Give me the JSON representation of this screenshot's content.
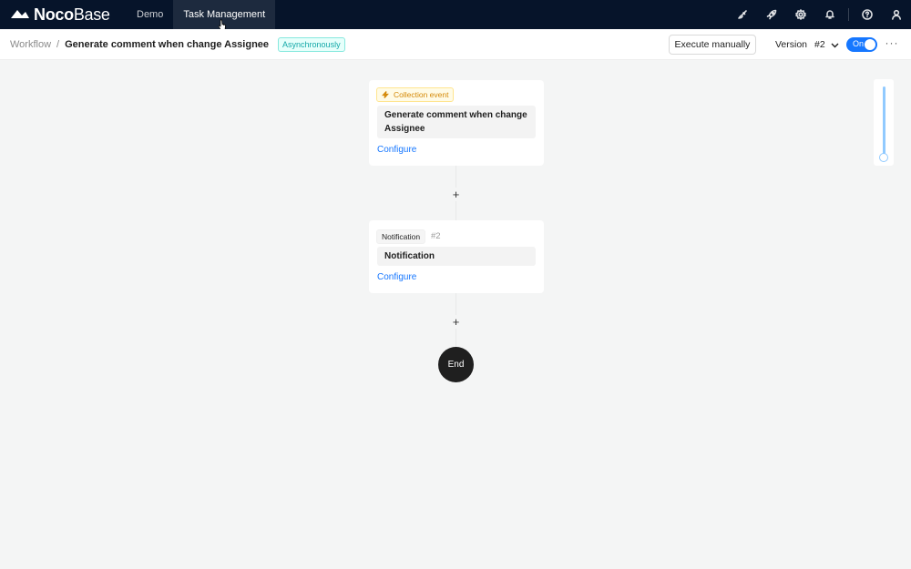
{
  "brand": {
    "name_bold": "Noco",
    "name_light": "Base"
  },
  "nav": {
    "items": [
      {
        "label": "Demo"
      },
      {
        "label": "Task Management"
      }
    ]
  },
  "top_icons": [
    "brush-icon",
    "rocket-icon",
    "gear-icon",
    "bell-icon",
    "help-icon",
    "user-icon"
  ],
  "breadcrumb": {
    "root": "Workflow",
    "separator": "/",
    "current": "Generate comment when change Assignee"
  },
  "workflow": {
    "mode_tag": "Asynchronously"
  },
  "toolbar": {
    "execute_label": "Execute manually",
    "version_label": "Version",
    "version_value": "#2",
    "toggle_label": "On",
    "more_label": "···"
  },
  "nodes": [
    {
      "tag": "Collection event",
      "title": "Generate comment when change Assignee",
      "link": "Configure"
    },
    {
      "tag": "Notification",
      "id": "#2",
      "title": "Notification",
      "link": "Configure"
    }
  ],
  "add_button": "+",
  "end_label": "End",
  "colors": {
    "topbar": "#06142a",
    "primary": "#1677ff",
    "event_tag": "#d48806",
    "async_tag": "#13a8a8"
  }
}
